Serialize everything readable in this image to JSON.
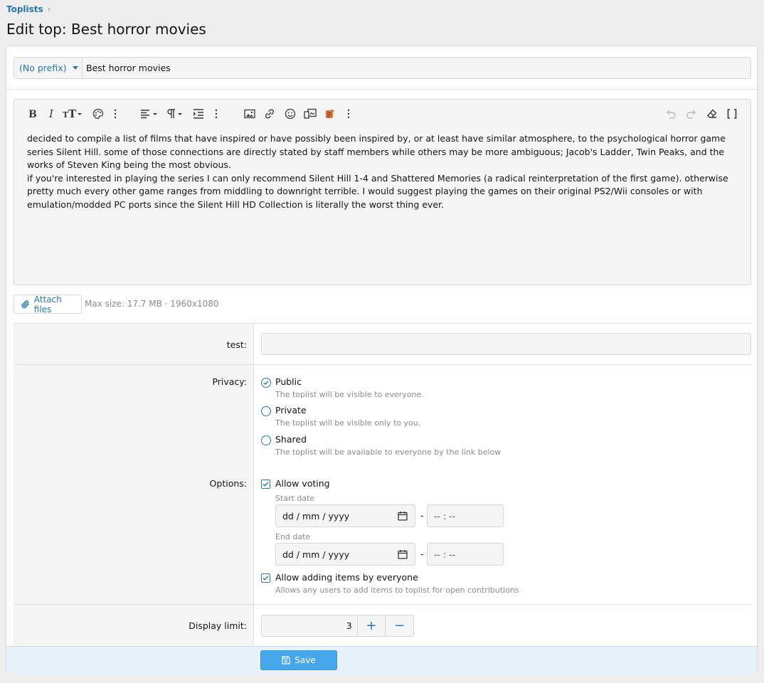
{
  "breadcrumb": {
    "item": "Toplists",
    "separator": "›"
  },
  "page_title": "Edit top: Best horror movies",
  "title_row": {
    "prefix": "(No prefix)",
    "title_value": "Best horror movies"
  },
  "editor": {
    "paragraphs": [
      "decided to compile a list of films that have inspired or have possibly been inspired by, or at least have similar atmosphere, to the psychological horror game series Silent Hill. some of those connections are directly stated by staff members while others may be more ambiguous; Jacob's Ladder, Twin Peaks, and the works of Steven King being the most obvious.",
      "if you're interested in playing the series I can only recommend Silent Hill 1-4 and Shattered Memories (a radical reinterpretation of the first game). otherwise pretty much every other game ranges from middling to downright terrible. I would suggest playing the games on their original PS2/Wii consoles or with emulation/modded PC ports since the Silent Hill HD Collection is literally the worst thing ever."
    ]
  },
  "attach": {
    "label": "Attach files",
    "hint": "Max size: 17.7 MB · 1960x1080"
  },
  "fields": {
    "test_label": "test:",
    "privacy_label": "Privacy:",
    "privacy_options": [
      {
        "label": "Public",
        "hint": "The toplist will be visible to everyone."
      },
      {
        "label": "Private",
        "hint": "The toplist will be visible only to you."
      },
      {
        "label": "Shared",
        "hint": "The toplist will be available to everyone by the link below"
      }
    ],
    "privacy_selected": 0,
    "options_label": "Options:",
    "allow_voting": "Allow voting",
    "start_date_label": "Start date",
    "end_date_label": "End date",
    "date_placeholder": "dd / mm / yyyy",
    "time_placeholder": "-- : --",
    "date_separator": "-",
    "allow_adding": "Allow adding items by everyone",
    "allow_adding_hint": "Allows any users to add items to toplist for open contributions",
    "display_limit_label": "Display limit:",
    "display_limit_value": "3",
    "increment_symbol": "+",
    "decrement_symbol": "−"
  },
  "save_label": "Save",
  "colors": {
    "accent": "#2577b1",
    "button": "#47a7eb",
    "footer": "#e8f2fa"
  }
}
